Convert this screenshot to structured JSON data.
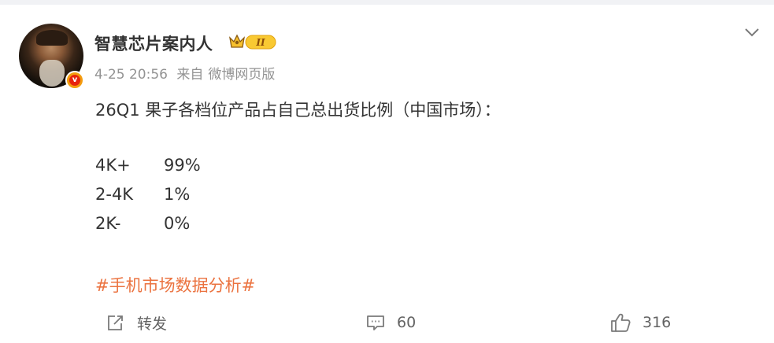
{
  "post": {
    "username": "智慧芯片案内人",
    "member_badge_text": "II",
    "timestamp": "4-25 20:56",
    "source_prefix": "来自",
    "source": "微博网页版",
    "headline": "26Q1 果子各档位产品占自己总出货比例（中国市场）：",
    "rows": [
      {
        "label": "4K+",
        "value": "99%"
      },
      {
        "label": "2-4K",
        "value": "1%"
      },
      {
        "label": "2K-",
        "value": "0%"
      }
    ],
    "hashtag": "#手机市场数据分析#"
  },
  "actions": {
    "repost_label": "转发",
    "comment_count": "60",
    "like_count": "316"
  },
  "colors": {
    "hashtag": "#eb7340",
    "badge_orange": "#f39d0f",
    "badge_red": "#e8240d",
    "meta_gray": "#939393"
  },
  "icons": {
    "avatar": "portrait",
    "verified": "verified-v-icon",
    "member": "crown-badge-icon",
    "menu": "chevron-down-icon",
    "repost": "repost-icon",
    "comment": "comment-icon",
    "like": "thumbs-up-icon"
  }
}
